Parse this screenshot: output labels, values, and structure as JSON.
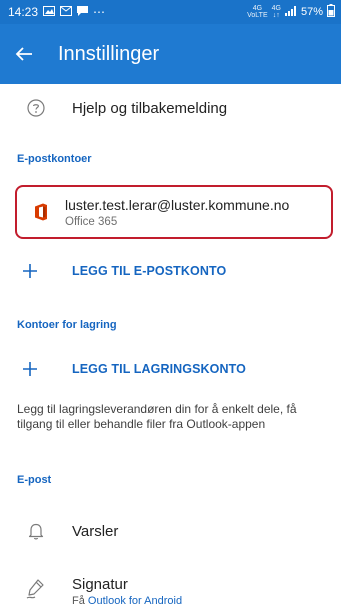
{
  "status_bar": {
    "time": "14:23",
    "net_top": "4G",
    "net_bottom": "VoLTE",
    "net2_top": "4G",
    "net2_bottom": "↓↑",
    "battery": "57%"
  },
  "app_bar": {
    "title": "Innstillinger"
  },
  "help": {
    "label": "Hjelp og tilbakemelding"
  },
  "email_accounts": {
    "header": "E-postkontoer",
    "account": {
      "email": "luster.test.lerar@luster.kommune.no",
      "type": "Office 365"
    },
    "add_label": "LEGG TIL E-POSTKONTO"
  },
  "storage_accounts": {
    "header": "Kontoer for lagring",
    "add_label": "LEGG TIL LAGRINGSKONTO",
    "description": "Legg til lagringsleverandøren din for å enkelt dele, få tilgang til eller behandle filer fra Outlook-appen"
  },
  "email_section": {
    "header": "E-post",
    "notifications_label": "Varsler",
    "signature_label": "Signatur",
    "signature_prefix": "Få ",
    "signature_link": "Outlook for Android"
  },
  "colors": {
    "accent": "#1f7ad1",
    "status_bar": "#1a73c9",
    "highlight_border": "#c21d2d",
    "office_red": "#d83b01"
  }
}
